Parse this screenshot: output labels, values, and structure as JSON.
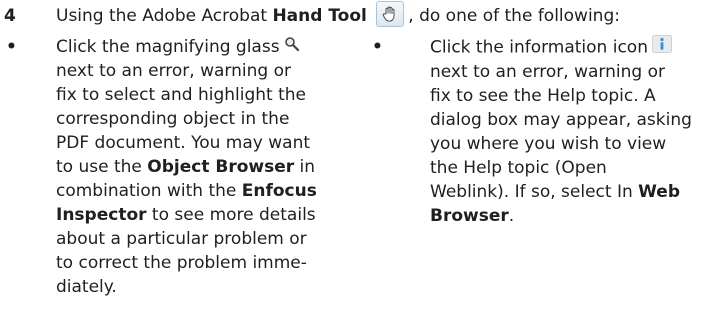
{
  "step": {
    "number": "4",
    "text_before": "Using the Adobe Acrobat ",
    "tool_name": "Hand Tool",
    "text_after": ", do one of the following:"
  },
  "bullets": [
    {
      "symbol": "•",
      "lines": [
        [
          "Click the magnifying glass"
        ],
        [
          "next to an error, warning or"
        ],
        [
          "fix to select and highlight the"
        ],
        [
          "corresponding object in the"
        ],
        [
          "PDF document. You may want"
        ],
        [
          "to use the ",
          "Object Browser",
          " in"
        ],
        [
          "combination with the ",
          "Enfocus"
        ],
        [
          "Inspector",
          " to see more details"
        ],
        [
          "about a particular problem or"
        ],
        [
          "to correct the problem imme-"
        ],
        [
          "diately."
        ]
      ]
    },
    {
      "symbol": "•",
      "lines": [
        [
          "Click the information icon"
        ],
        [
          "next to an error, warning or"
        ],
        [
          "fix to see the Help topic. A"
        ],
        [
          "dialog box may appear, asking"
        ],
        [
          "you where you wish to view"
        ],
        [
          "the Help topic (Open"
        ],
        [
          "Weblink). If so, select In ",
          "Web"
        ],
        [
          "Browser",
          "."
        ]
      ]
    }
  ],
  "icons": {
    "hand": "hand-tool-icon",
    "magnifier": "magnifying-glass-icon",
    "info": "information-icon"
  }
}
